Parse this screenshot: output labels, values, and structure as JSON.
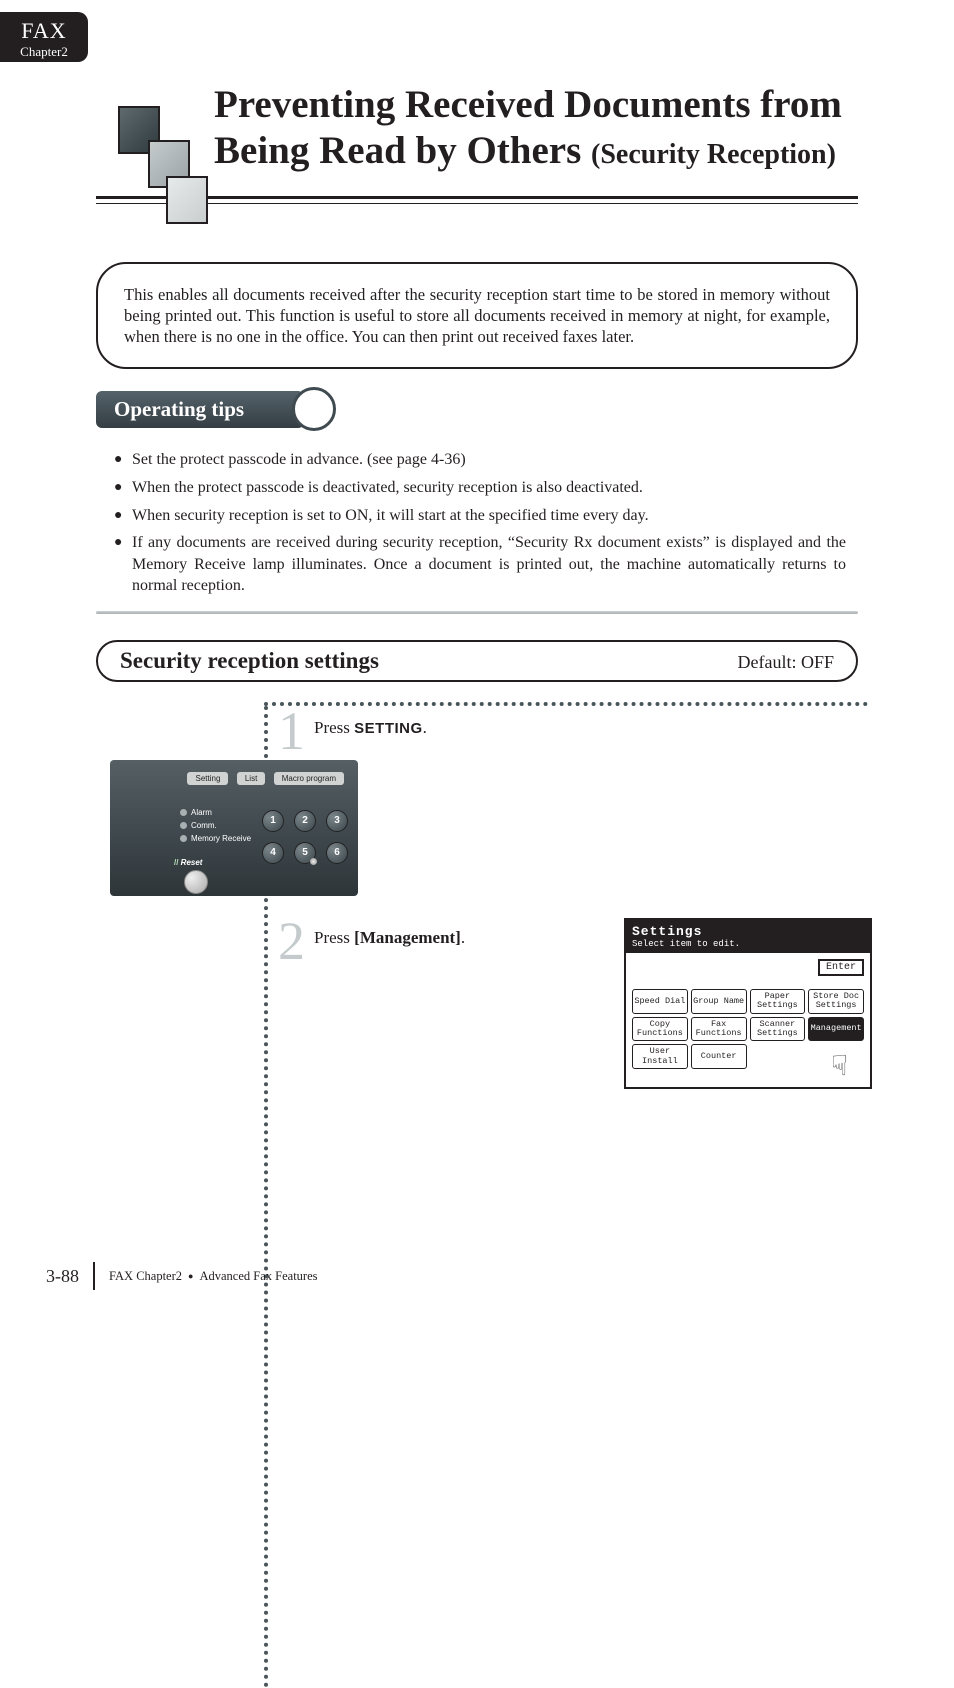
{
  "tab": {
    "line1": "FAX",
    "line2": "Chapter2"
  },
  "title": {
    "line1": "Preventing Received Documents from",
    "line2_strong": "Being Read by Others",
    "line2_paren": "(Security Reception)"
  },
  "intro": "This enables all documents received after the security reception start time to be stored in memory without being printed out. This function is useful to store all documents received in memory at night, for example, when there is no one in the office. You can then print out received faxes later.",
  "tips": {
    "heading": "Operating tips",
    "items": [
      "Set the protect passcode in advance. (see page 4-36)",
      "When the protect passcode is deactivated, security reception is also deactivated.",
      "When security reception is set to ON, it will start at the specified time every day.",
      "If any documents are received during security reception, “Security Rx document exists” is displayed and the Memory Receive lamp illuminates. Once a document is printed out, the machine automatically returns to normal reception."
    ]
  },
  "section": {
    "title": "Security reception settings",
    "default": "Default: OFF"
  },
  "steps": [
    {
      "num": "1",
      "pre": "Press ",
      "bold": "SETTING",
      "post": "."
    },
    {
      "num": "2",
      "pre": "Press ",
      "bold": "[Management]",
      "post": "."
    }
  ],
  "panel1": {
    "top_buttons": [
      "Setting",
      "List",
      "Macro program"
    ],
    "leds": [
      "Alarm",
      "Comm.",
      "Memory Receive"
    ],
    "reset": "Reset",
    "keys": [
      [
        "1",
        "2",
        "3"
      ],
      [
        "4",
        "5",
        "6"
      ]
    ]
  },
  "panel2": {
    "h1": "Settings",
    "h2": "Select item to edit.",
    "enter": "Enter",
    "buttons": [
      {
        "t": "Speed Dial",
        "hl": false
      },
      {
        "t": "Group Name",
        "hl": false
      },
      {
        "t": "Paper\nSettings",
        "hl": false
      },
      {
        "t": "Store Doc\nSettings",
        "hl": false
      },
      {
        "t": "Copy\nFunctions",
        "hl": false
      },
      {
        "t": "Fax\nFunctions",
        "hl": false
      },
      {
        "t": "Scanner\nSettings",
        "hl": false
      },
      {
        "t": "Management",
        "hl": true
      },
      {
        "t": "User\nInstall",
        "hl": false
      },
      {
        "t": "Counter",
        "hl": false
      }
    ]
  },
  "footer": {
    "page": "3-88",
    "crumb1": "FAX Chapter2",
    "crumb2": "Advanced Fax Features"
  }
}
